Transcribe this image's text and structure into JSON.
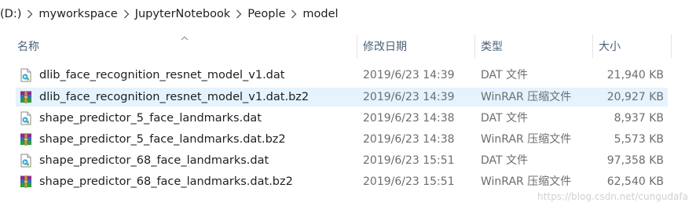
{
  "breadcrumb": [
    "(D:)",
    "myworkspace",
    "JupyterNotebook",
    "People",
    "model"
  ],
  "columns": {
    "name": "名称",
    "date": "修改日期",
    "type": "类型",
    "size": "大小"
  },
  "files": [
    {
      "name": "dlib_face_recognition_resnet_model_v1.dat",
      "date": "2019/6/23 14:39",
      "type": "DAT 文件",
      "size": "21,940 KB",
      "icon": "dat-file-icon",
      "selected": false
    },
    {
      "name": "dlib_face_recognition_resnet_model_v1.dat.bz2",
      "date": "2019/6/23 14:39",
      "type": "WinRAR 压缩文件",
      "size": "20,927 KB",
      "icon": "winrar-archive-icon",
      "selected": true
    },
    {
      "name": "shape_predictor_5_face_landmarks.dat",
      "date": "2019/6/23 14:38",
      "type": "DAT 文件",
      "size": "8,937 KB",
      "icon": "dat-file-icon",
      "selected": false
    },
    {
      "name": "shape_predictor_5_face_landmarks.dat.bz2",
      "date": "2019/6/23 14:38",
      "type": "WinRAR 压缩文件",
      "size": "5,573 KB",
      "icon": "winrar-archive-icon",
      "selected": false
    },
    {
      "name": "shape_predictor_68_face_landmarks.dat",
      "date": "2019/6/23 15:51",
      "type": "DAT 文件",
      "size": "97,358 KB",
      "icon": "dat-file-icon",
      "selected": false
    },
    {
      "name": "shape_predictor_68_face_landmarks.dat.bz2",
      "date": "2019/6/23 15:51",
      "type": "WinRAR 压缩文件",
      "size": "62,540 KB",
      "icon": "winrar-archive-icon",
      "selected": false
    }
  ],
  "watermark": "https://blog.csdn.net/cungudafa",
  "colors": {
    "selected_row": "#e5f3ff",
    "header_text": "#4c607a",
    "secondary_text": "#6d6d6d"
  }
}
